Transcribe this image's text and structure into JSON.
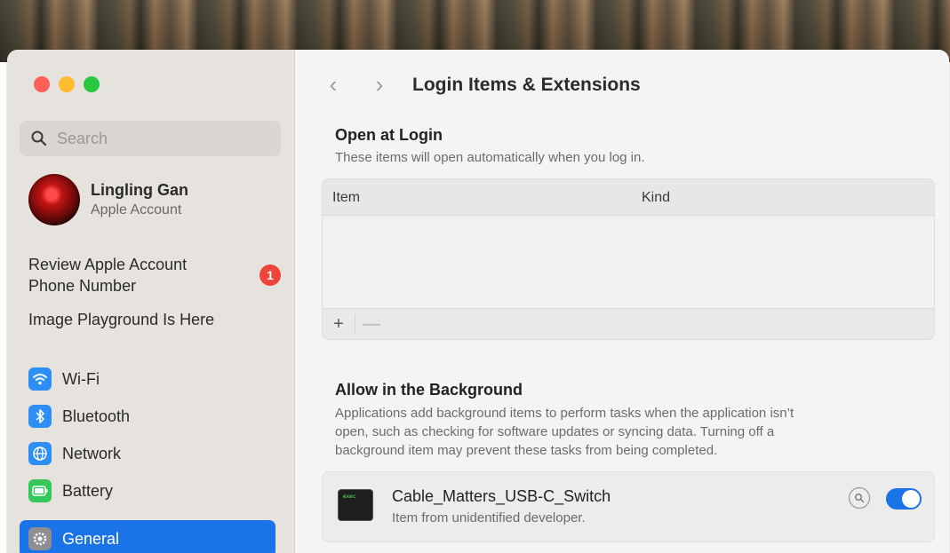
{
  "sidebar": {
    "search_placeholder": "Search",
    "account": {
      "name": "Lingling Gan",
      "subtitle": "Apple Account"
    },
    "notices": [
      {
        "label_line1": "Review Apple Account",
        "label_line2": "Phone Number",
        "badge": "1"
      },
      {
        "label": "Image Playground Is Here"
      }
    ],
    "items": [
      {
        "label": "Wi-Fi",
        "icon": "wifi-icon"
      },
      {
        "label": "Bluetooth",
        "icon": "bluetooth-icon"
      },
      {
        "label": "Network",
        "icon": "globe-icon"
      },
      {
        "label": "Battery",
        "icon": "battery-icon"
      },
      {
        "label": "General",
        "icon": "gear-icon",
        "selected": true
      }
    ]
  },
  "main": {
    "title": "Login Items & Extensions",
    "open_at_login": {
      "heading": "Open at Login",
      "description": "These items will open automatically when you log in.",
      "columns": [
        "Item",
        "Kind"
      ],
      "add_label": "+",
      "remove_label": "—"
    },
    "background": {
      "heading": "Allow in the Background",
      "description_lines": [
        "Applications add background items to perform tasks when the application isn’t",
        "open, such as checking for software updates or syncing data. Turning off a",
        "background item may prevent these tasks from being completed."
      ],
      "item": {
        "name": "Cable_Matters_USB-C_Switch",
        "subtitle": "Item from unidentified developer.",
        "icon_text": "exec",
        "enabled": true
      }
    }
  },
  "colors": {
    "accent": "#1b73e8",
    "badge": "#f0443a"
  }
}
